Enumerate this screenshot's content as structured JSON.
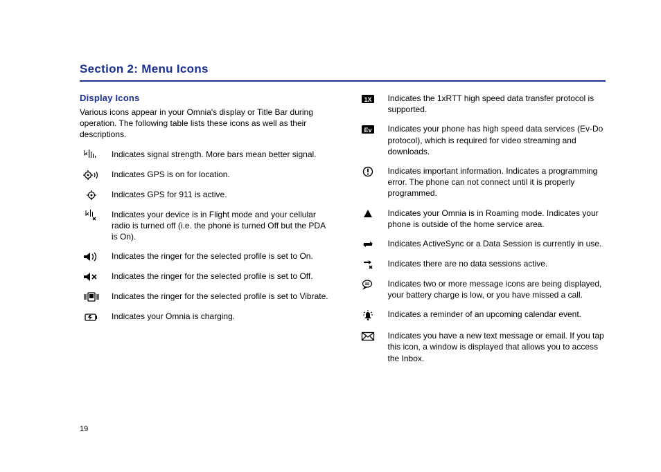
{
  "section_title": "Section 2: Menu Icons",
  "subsection_title": "Display Icons",
  "intro": "Various icons appear in your Omnia's display or Title Bar during operation. The following table lists these icons as well as their descriptions.",
  "page_number": "19",
  "left_icons": [
    {
      "name": "signal-strength-icon",
      "desc": "Indicates signal strength. More bars mean better signal."
    },
    {
      "name": "gps-location-icon",
      "desc": "Indicates GPS is on for location."
    },
    {
      "name": "gps-911-icon",
      "desc": "Indicates GPS for 911 is active."
    },
    {
      "name": "flight-mode-icon",
      "desc": "Indicates your device is in Flight mode and your cellular radio is turned off (i.e. the phone is turned Off but the PDA is On)."
    },
    {
      "name": "ringer-on-icon",
      "desc": "Indicates the ringer for the selected profile is set to On."
    },
    {
      "name": "ringer-off-icon",
      "desc": "Indicates the ringer for the selected profile is set to Off."
    },
    {
      "name": "ringer-vibrate-icon",
      "desc": "Indicates the ringer for the selected profile is set to Vibrate."
    },
    {
      "name": "charging-icon",
      "desc": "Indicates your Omnia is charging."
    }
  ],
  "right_icons": [
    {
      "name": "1x-badge-icon",
      "label": "1X",
      "desc": "Indicates the 1xRTT high speed data transfer protocol is supported."
    },
    {
      "name": "ev-badge-icon",
      "label": "Ev",
      "desc": "Indicates your phone has high speed data services (Ev-Do protocol), which is required for video streaming and downloads."
    },
    {
      "name": "alert-icon",
      "desc": "Indicates important information. Indicates a programming error. The phone can not connect until it is properly programmed."
    },
    {
      "name": "roaming-icon",
      "desc": "Indicates your Omnia is in Roaming mode. Indicates your phone is outside of the home service area."
    },
    {
      "name": "sync-active-icon",
      "desc": "Indicates ActiveSync or a Data Session is currently in use."
    },
    {
      "name": "no-data-session-icon",
      "desc": "Indicates there are no data sessions active."
    },
    {
      "name": "multi-status-icon",
      "desc": "Indicates two or more message icons are being displayed, your battery charge is low, or you have missed a call."
    },
    {
      "name": "calendar-reminder-icon",
      "desc": "Indicates a reminder of an upcoming calendar event."
    },
    {
      "name": "message-icon",
      "desc": "Indicates you have a new text message or email. If you tap this  icon, a window is displayed that allows you to access the Inbox."
    }
  ]
}
